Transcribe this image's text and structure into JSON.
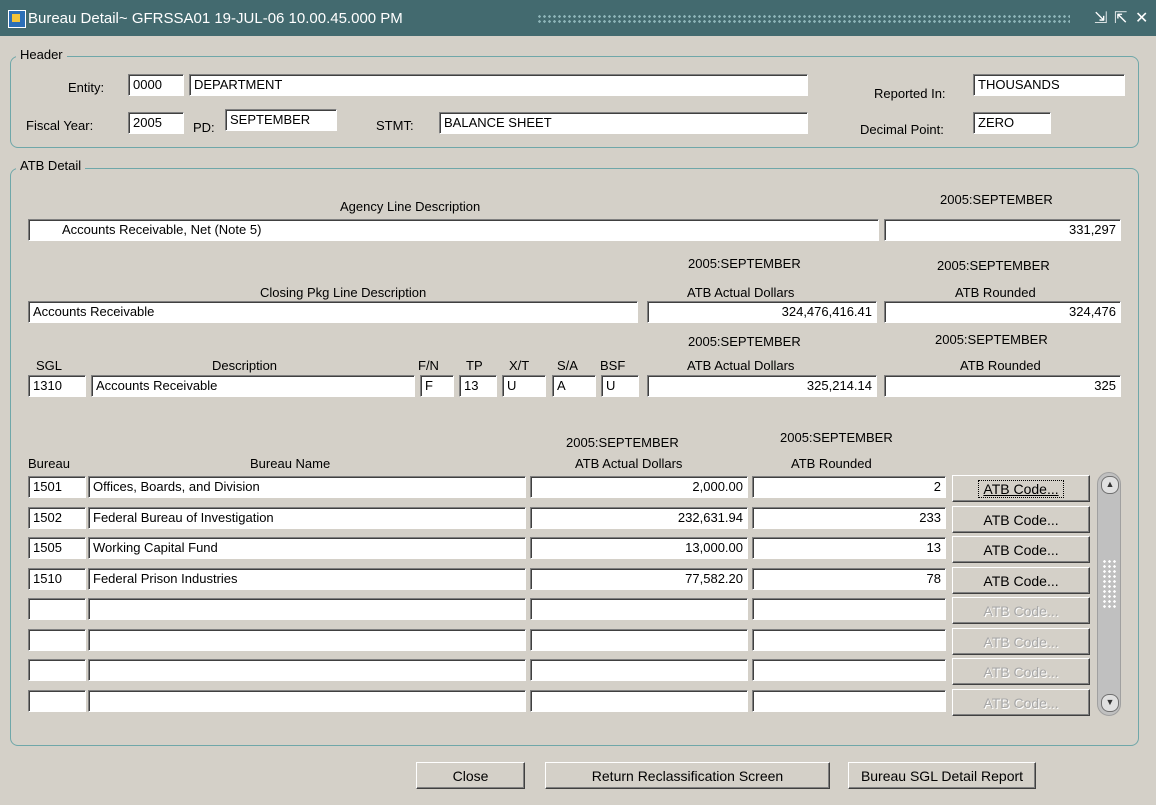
{
  "window": {
    "title": "Bureau Detail~ GFRSSA01  19-JUL-06 10.00.45.000 PM",
    "minimize_glyph": "⇲",
    "maximize_glyph": "⇱",
    "close_glyph": "✕"
  },
  "header": {
    "legend": "Header",
    "entity_label": "Entity:",
    "entity_code": "0000",
    "entity_name": "DEPARTMENT",
    "reported_in_label": "Reported In:",
    "reported_in": "THOUSANDS",
    "fiscal_year_label": "Fiscal Year:",
    "fiscal_year": "2005",
    "pd_label": "PD:",
    "pd": "SEPTEMBER",
    "stmt_label": "STMT:",
    "stmt": "BALANCE SHEET",
    "decimal_point_label": "Decimal Point:",
    "decimal_point": "ZERO"
  },
  "atb_detail": {
    "legend": "ATB Detail",
    "agency": {
      "desc_header": "Agency Line Description",
      "period_header": "2005:SEPTEMBER",
      "description": "Accounts Receivable, Net (Note 5)",
      "amount": "331,297"
    },
    "closing": {
      "desc_header": "Closing Pkg Line Description",
      "period_actual": "2005:SEPTEMBER",
      "period_rounded": "2005:SEPTEMBER",
      "actual_header": "ATB Actual Dollars",
      "rounded_header": "ATB Rounded",
      "description": "Accounts Receivable",
      "actual": "324,476,416.41",
      "rounded": "324,476"
    },
    "sgl": {
      "sgl_header": "SGL",
      "desc_header": "Description",
      "fn_header": "F/N",
      "tp_header": "TP",
      "xt_header": "X/T",
      "sa_header": "S/A",
      "bsf_header": "BSF",
      "period_actual": "2005:SEPTEMBER",
      "period_rounded": "2005:SEPTEMBER",
      "actual_header": "ATB Actual Dollars",
      "rounded_header": "ATB Rounded",
      "sgl": "1310",
      "description": "Accounts Receivable",
      "fn": "F",
      "tp": "13",
      "xt": "U",
      "sa": "A",
      "bsf": "U",
      "actual": "325,214.14",
      "rounded": "325"
    },
    "bureaus": {
      "bureau_header": "Bureau",
      "name_header": "Bureau Name",
      "period_actual": "2005:SEPTEMBER",
      "period_rounded": "2005:SEPTEMBER",
      "actual_header": "ATB Actual Dollars",
      "rounded_header": "ATB Rounded",
      "rows": [
        {
          "code": "1501",
          "name": "Offices, Boards, and Division",
          "actual": "2,000.00",
          "rounded": "2",
          "button": "ATB Code..."
        },
        {
          "code": "1502",
          "name": "Federal Bureau of Investigation",
          "actual": "232,631.94",
          "rounded": "233",
          "button": "ATB Code..."
        },
        {
          "code": "1505",
          "name": "Working Capital Fund",
          "actual": "13,000.00",
          "rounded": "13",
          "button": "ATB Code..."
        },
        {
          "code": "1510",
          "name": "Federal Prison Industries",
          "actual": "77,582.20",
          "rounded": "78",
          "button": "ATB Code..."
        },
        {
          "code": "",
          "name": "",
          "actual": "",
          "rounded": "",
          "button": "ATB Code..."
        },
        {
          "code": "",
          "name": "",
          "actual": "",
          "rounded": "",
          "button": "ATB Code..."
        },
        {
          "code": "",
          "name": "",
          "actual": "",
          "rounded": "",
          "button": "ATB Code..."
        },
        {
          "code": "",
          "name": "",
          "actual": "",
          "rounded": "",
          "button": "ATB Code..."
        }
      ]
    }
  },
  "footer": {
    "close_label": "Close",
    "return_label": "Return Reclassification Screen",
    "report_label": "Bureau SGL Detail Report"
  },
  "icons": {
    "scroll_up": "▲",
    "scroll_down": "▼"
  }
}
